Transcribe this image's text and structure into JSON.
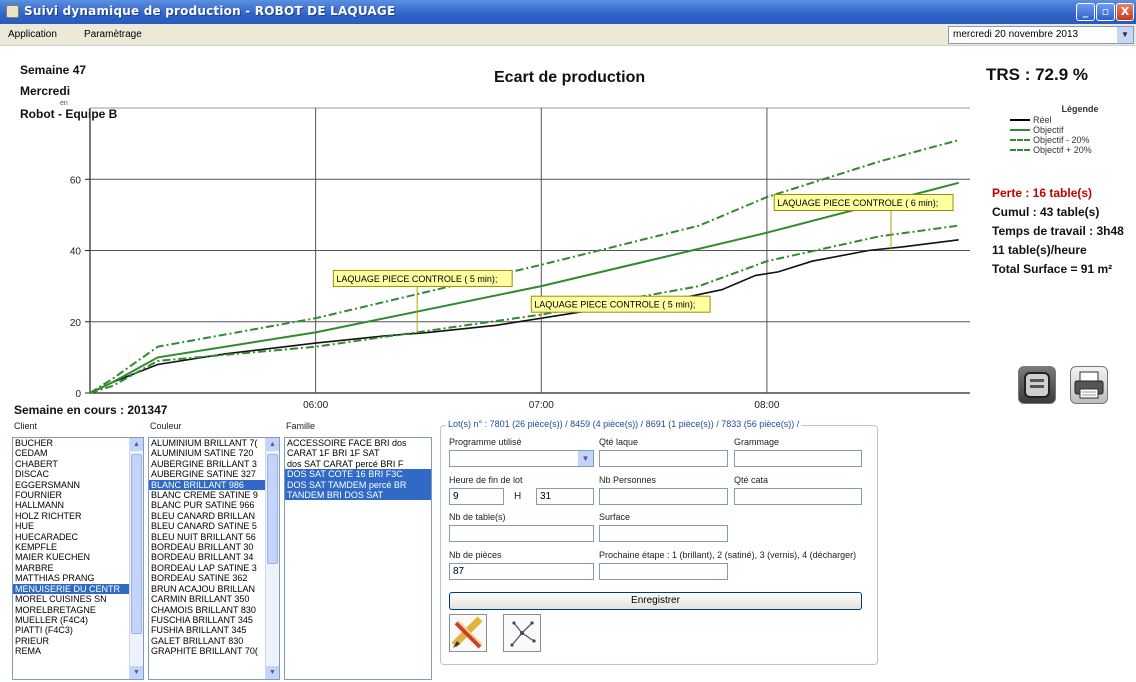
{
  "window": {
    "title": "Suivi dynamique de production - ROBOT DE LAQUAGE",
    "min": "_",
    "max": "▫",
    "close": "X"
  },
  "menu": {
    "items": [
      "Application",
      "Paramètrage"
    ],
    "date": "mercredi 20 novembre 2013"
  },
  "header": {
    "week": "Semaine 47",
    "day": "Mercredi",
    "en": "en",
    "team": "Robot - Equipe B",
    "chart_title": "Ecart de production",
    "trs": "TRS : 72.9 %"
  },
  "legend": {
    "title": "Légende",
    "items": [
      {
        "label": "Réel",
        "color": "#000000",
        "style": "solid"
      },
      {
        "label": "Objectif",
        "color": "#2e8b2e",
        "style": "solid"
      },
      {
        "label": "Objectif - 20%",
        "color": "#2e8b2e",
        "style": "dashdot"
      },
      {
        "label": "Objectif + 20%",
        "color": "#2e8b2e",
        "style": "dashdot"
      }
    ]
  },
  "stats": {
    "perte": "Perte : 16 table(s)",
    "cumul": "Cumul : 43 table(s)",
    "temps": "Temps de travail : 3h48",
    "rate": "11 table(s)/heure",
    "surface": "Total Surface = 91 m²"
  },
  "chart_data": {
    "type": "line",
    "title": "Ecart de production",
    "xlabel": "",
    "ylabel": "",
    "x_ticks": [
      "06:00",
      "07:00",
      "08:00"
    ],
    "y_ticks": [
      0,
      20,
      40,
      60
    ],
    "ylim": [
      0,
      80
    ],
    "xlim": [
      5.0,
      8.9
    ],
    "grid": true,
    "series": [
      {
        "name": "Réel",
        "color": "#111111",
        "dash": "",
        "x": [
          5.0,
          5.1,
          5.3,
          5.6,
          6.0,
          6.3,
          6.5,
          6.8,
          7.0,
          7.2,
          7.5,
          7.8,
          7.95,
          8.05,
          8.2,
          8.45,
          8.6,
          8.85
        ],
        "y": [
          0,
          3,
          8,
          11,
          14,
          16,
          17,
          19,
          21,
          23,
          25,
          29,
          33,
          34,
          37,
          40,
          41,
          43
        ]
      },
      {
        "name": "Objectif",
        "color": "#2e8b2e",
        "dash": "",
        "x": [
          5.0,
          5.1,
          5.3,
          6.0,
          7.0,
          8.0,
          8.85
        ],
        "y": [
          0,
          3,
          10,
          17,
          30,
          45,
          59
        ]
      },
      {
        "name": "Objectif - 20%",
        "color": "#2e8b2e",
        "dash": "8,3,2,3",
        "x": [
          5.0,
          5.1,
          5.3,
          6.0,
          7.0,
          7.7,
          8.0,
          8.5,
          8.85
        ],
        "y": [
          0,
          2,
          9,
          13,
          22,
          30,
          37,
          44,
          47
        ]
      },
      {
        "name": "Objectif + 20%",
        "color": "#2e8b2e",
        "dash": "8,3,2,3",
        "x": [
          5.0,
          5.1,
          5.3,
          6.0,
          7.0,
          7.7,
          8.0,
          8.5,
          8.85
        ],
        "y": [
          0,
          4,
          13,
          21,
          36,
          47,
          55,
          65,
          71
        ]
      }
    ],
    "annotations": [
      {
        "text": "LAQUAGE PIECE CONTROLE ( 5 min);",
        "x": 6.45,
        "y": 17
      },
      {
        "text": "LAQUAGE PIECE CONTROLE ( 5 min);",
        "x": 7.0,
        "y": 21
      },
      {
        "text": "LAQUAGE PIECE CONTROLE ( 6 min);",
        "x": 8.55,
        "y": 40
      }
    ]
  },
  "bottom": {
    "semaine": "Semaine en cours : 201347",
    "client_label": "Client",
    "couleur_label": "Couleur",
    "famille_label": "Famille",
    "clients": [
      "BUCHER",
      "CEDAM",
      "CHABERT",
      "DISCAC",
      "EGGERSMANN",
      "FOURNIER",
      "HALLMANN",
      "HOLZ RICHTER",
      "HUE",
      "HUECARADEC",
      "KEMPFLE",
      "MAIER KUECHEN",
      "MARBRE",
      "MATTHIAS PRANG",
      "MENUISERIE DU CENTR",
      "MOREL CUISINES SN",
      "MORELBRETAGNE",
      "MUELLER (F4C4)",
      "PIATTI (F4C3)",
      "PRIEUR",
      "REMA"
    ],
    "clients_selected": 14,
    "couleurs": [
      "ALUMINIUM BRILLANT 7(",
      "ALUMINIUM SATINE 720",
      "AUBERGINE BRILLANT 3",
      "AUBERGINE SATINE 327",
      "BLANC BRILLANT 986",
      "BLANC CREME SATINE 9",
      "BLANC PUR SATINE 966",
      "BLEU CANARD BRILLAN",
      "BLEU CANARD SATINE 5",
      "BLEU NUIT BRILLANT 56",
      "BORDEAU BRILLANT 30",
      "BORDEAU BRILLANT 34",
      "BORDEAU LAP SATINE 3",
      "BORDEAU SATINE 362",
      "BRUN ACAJOU BRILLAN",
      "CARMIN BRILLANT 350",
      "CHAMOIS BRILLANT 830",
      "FUSCHIA BRILLANT 345",
      "FUSHIA BRILLANT 345",
      "GALET BRILLANT 830",
      "GRAPHITE BRILLANT 70("
    ],
    "couleurs_selected": 4,
    "familles": [
      "ACCESSOIRE FACE BRI dos",
      "CARAT 1F BRI 1F SAT",
      "dos SAT CARAT percé BRI F",
      "DOS SAT COTE 16 BRI F3C",
      "DOS SAT TAMDEM percé BR",
      "TANDEM BRI DOS SAT"
    ],
    "familles_selected": [
      3,
      4,
      5
    ]
  },
  "form": {
    "lots": "Lot(s) n° : 7801 (26 pièce(s)) / 8459 (4 pièce(s)) / 8691 (1 pièce(s)) / 7833 (56 pièce(s)) /",
    "programme_label": "Programme utilisé",
    "programme_value": "",
    "qte_laque_label": "Qté laque",
    "qte_laque_value": "",
    "grammage_label": "Grammage",
    "grammage_value": "",
    "heure_label": "Heure de fin de lot",
    "heure_h": "9",
    "h_sep": "H",
    "heure_m": "31",
    "nb_personnes_label": "Nb Personnes",
    "nb_personnes_value": "",
    "qte_cata_label": "Qté cata",
    "qte_cata_value": "",
    "nb_tables_label": "Nb de table(s)",
    "nb_tables_value": "",
    "surface_label": "Surface",
    "surface_value": "",
    "nb_pieces_label": "Nb de pièces",
    "nb_pieces_value": "87",
    "prochaine_label": "Prochaine étape : 1 (brillant), 2 (satiné), 3 (vernis), 4 (décharger)",
    "prochaine_value": "",
    "enregistrer": "Enregistrer"
  },
  "icons": {
    "edit": "pencil-ruler-icon",
    "tree": "network-tree-icon",
    "terminal": "terminal-icon",
    "printer": "printer-icon"
  }
}
